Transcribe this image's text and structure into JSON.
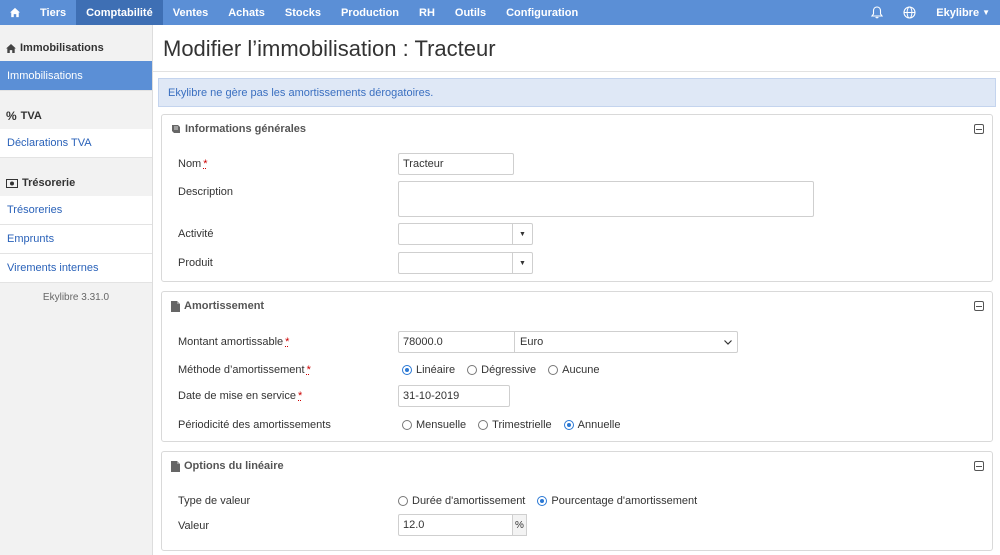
{
  "nav": {
    "home_icon": "home-icon",
    "items": [
      "Tiers",
      "Comptabilité",
      "Ventes",
      "Achats",
      "Stocks",
      "Production",
      "RH",
      "Outils",
      "Configuration"
    ],
    "active_index": 1,
    "user": "Ekylibre",
    "bell_icon": "bell-icon",
    "globe_icon": "globe-icon"
  },
  "sidebar": {
    "section1": {
      "title": "Immobilisations",
      "items": [
        "Immobilisations"
      ]
    },
    "section2": {
      "title": "TVA",
      "items": [
        "Déclarations TVA"
      ]
    },
    "section3": {
      "title": "Trésorerie",
      "items": [
        "Trésoreries",
        "Emprunts",
        "Virements internes"
      ]
    },
    "version": "Ekylibre 3.31.0"
  },
  "page": {
    "title": "Modifier l’immobilisation : Tracteur",
    "alert": "Ekylibre ne gère pas les amortissements dérogatoires."
  },
  "general": {
    "heading": "Informations générales",
    "name_label": "Nom",
    "name_value": "Tracteur",
    "description_label": "Description",
    "description_value": "",
    "activity_label": "Activité",
    "product_label": "Produit"
  },
  "depreciation": {
    "heading": "Amortissement",
    "amount_label": "Montant amortissable",
    "amount_value": "78000.0",
    "currency": "Euro",
    "method_label": "Méthode d’amortissement",
    "methods": [
      "Linéaire",
      "Dégressive",
      "Aucune"
    ],
    "method_selected": 0,
    "date_label": "Date de mise en service",
    "date_value": "31-10-2019",
    "period_label": "Périodicité des amortissements",
    "periods": [
      "Mensuelle",
      "Trimestrielle",
      "Annuelle"
    ],
    "period_selected": 2
  },
  "linear": {
    "heading": "Options du linéaire",
    "type_label": "Type de valeur",
    "types": [
      "Durée d'amortissement",
      "Pourcentage d'amortissement"
    ],
    "type_selected": 1,
    "value_label": "Valeur",
    "value": "12.0",
    "unit": "%"
  },
  "colors": {
    "nav": "#5b8fd6",
    "nav_active": "#3e6fb4",
    "link": "#2a62b9",
    "alert_bg": "#dfe8f6"
  }
}
